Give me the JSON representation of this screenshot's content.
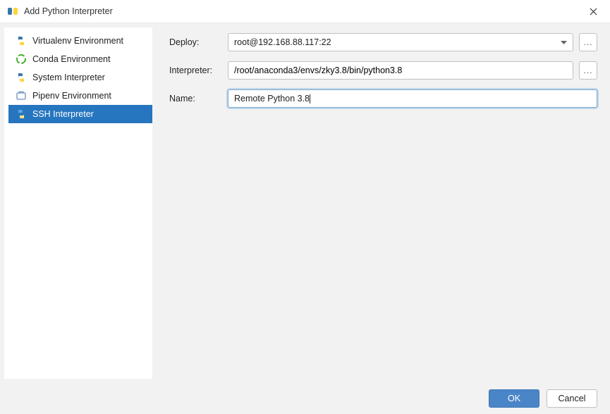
{
  "window": {
    "title": "Add Python Interpreter"
  },
  "sidebar": {
    "items": [
      {
        "label": "Virtualenv Environment",
        "icon": "python-v",
        "selected": false
      },
      {
        "label": "Conda Environment",
        "icon": "conda",
        "selected": false
      },
      {
        "label": "System Interpreter",
        "icon": "python",
        "selected": false
      },
      {
        "label": "Pipenv Environment",
        "icon": "pipenv",
        "selected": false
      },
      {
        "label": "SSH Interpreter",
        "icon": "ssh-python",
        "selected": true
      }
    ]
  },
  "form": {
    "deploy": {
      "label": "Deploy:",
      "value": "root@192.168.88.117:22"
    },
    "interpreter": {
      "label": "Interpreter:",
      "value": "/root/anaconda3/envs/zky3.8/bin/python3.8"
    },
    "name": {
      "label": "Name:",
      "value": "Remote Python 3.8"
    }
  },
  "buttons": {
    "browse": "...",
    "ok": "OK",
    "cancel": "Cancel"
  }
}
